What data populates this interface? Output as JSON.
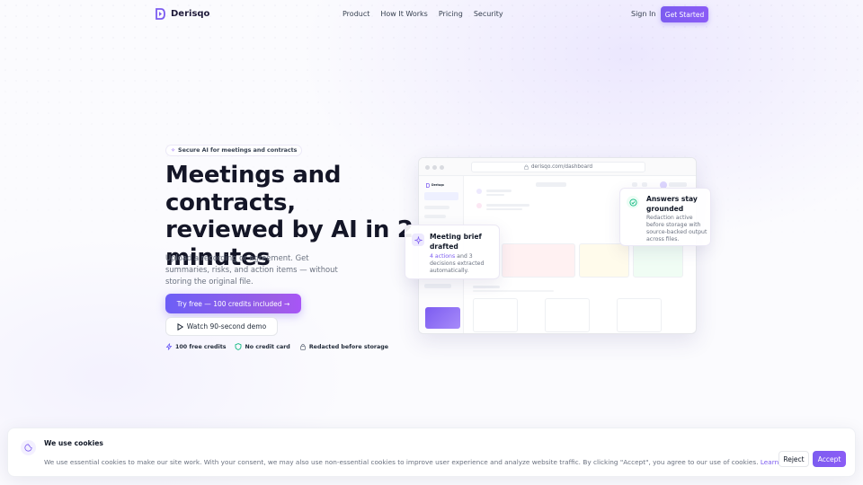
{
  "brand": {
    "name": "Derisqo",
    "color": "#7c5cf0"
  },
  "nav": {
    "links": [
      "Product",
      "How It Works",
      "Pricing",
      "Security"
    ],
    "sign_in": "Sign In",
    "get_started": "Get Started"
  },
  "hero": {
    "badge": "Secure AI for meetings and contracts",
    "badge_icon": "sparkle-icon",
    "title": "Meetings and contracts, reviewed by AI in 2 minutes",
    "subtitle": "Upload a recording or agreement. Get summaries, risks, and action items — without storing the original file.",
    "primary_cta": "Try free — 100 credits included →",
    "secondary_cta": "Watch 90-second demo",
    "features": [
      {
        "icon": "bolt-icon",
        "label": "100 free credits"
      },
      {
        "icon": "shield-icon",
        "label": "No credit card"
      },
      {
        "icon": "lock-icon",
        "label": "Redacted before storage"
      }
    ]
  },
  "preview": {
    "url": "derisqo.com/dashboard",
    "app_name": "Derisqo",
    "cards": {
      "grounded": {
        "icon": "check-circle-icon",
        "title": "Answers stay grounded",
        "description": "Redaction active before storage with source-backed output across files."
      },
      "brief": {
        "icon": "sparkle-icon",
        "title": "Meeting brief drafted",
        "description_highlight": "4 actions",
        "description_rest": " and 3 decisions extracted automatically."
      }
    }
  },
  "cookie": {
    "icon": "cookie-icon",
    "title": "We use cookies",
    "text": "We use essential cookies to make our site work. With your consent, we may also use non-essential cookies to improve user experience and analyze website traffic. By clicking \"Accept\", you agree to our use of cookies.",
    "learn_more": "Learn more",
    "reject": "Reject",
    "accept": "Accept"
  }
}
